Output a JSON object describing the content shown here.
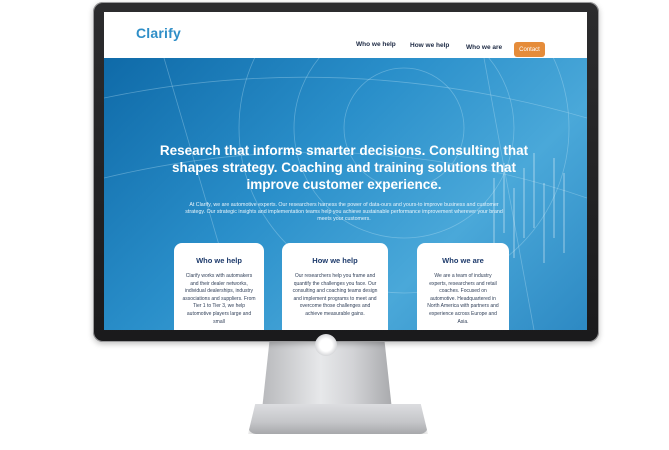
{
  "nav": {
    "logo": "Clarify",
    "links": [
      "Who we help",
      "How we help",
      "Who we are"
    ],
    "contact": "Contact"
  },
  "hero": {
    "title": "Research that informs smarter decisions.  Consulting that shapes strategy. Coaching and training solutions that improve customer experience.",
    "subtitle": "At Clarify, we are automotive experts. Our researchers harness the power of data-ours and yours-to improve business and customer strategy. Our strategic insights and implementation teams help you achieve sustainable performance improvement wherever your brand meets your customers."
  },
  "cards": [
    {
      "title": "Who we help",
      "body": "Clarify works with automakers and their dealer networks, individual dealerships, industry associations and suppliers. From Tier 1 to Tier 3, we help automotive players large and small"
    },
    {
      "title": "How we help",
      "body": "Our researchers help you frame and quantify the challenges you face. Our consulting and coaching teams design and implement programs to meet and overcome those challenges and achieve measurable gains."
    },
    {
      "title": "Who we are",
      "body": "We are a team of industry experts, researchers and retail coaches. Focused on automotive. Headquartered in North America with partners and experience across Europe and Asia."
    }
  ],
  "colors": {
    "brand": "#2e8ec7",
    "accent": "#e58c3a",
    "hero": "#2a8fca",
    "navy": "#1d3a6b"
  }
}
